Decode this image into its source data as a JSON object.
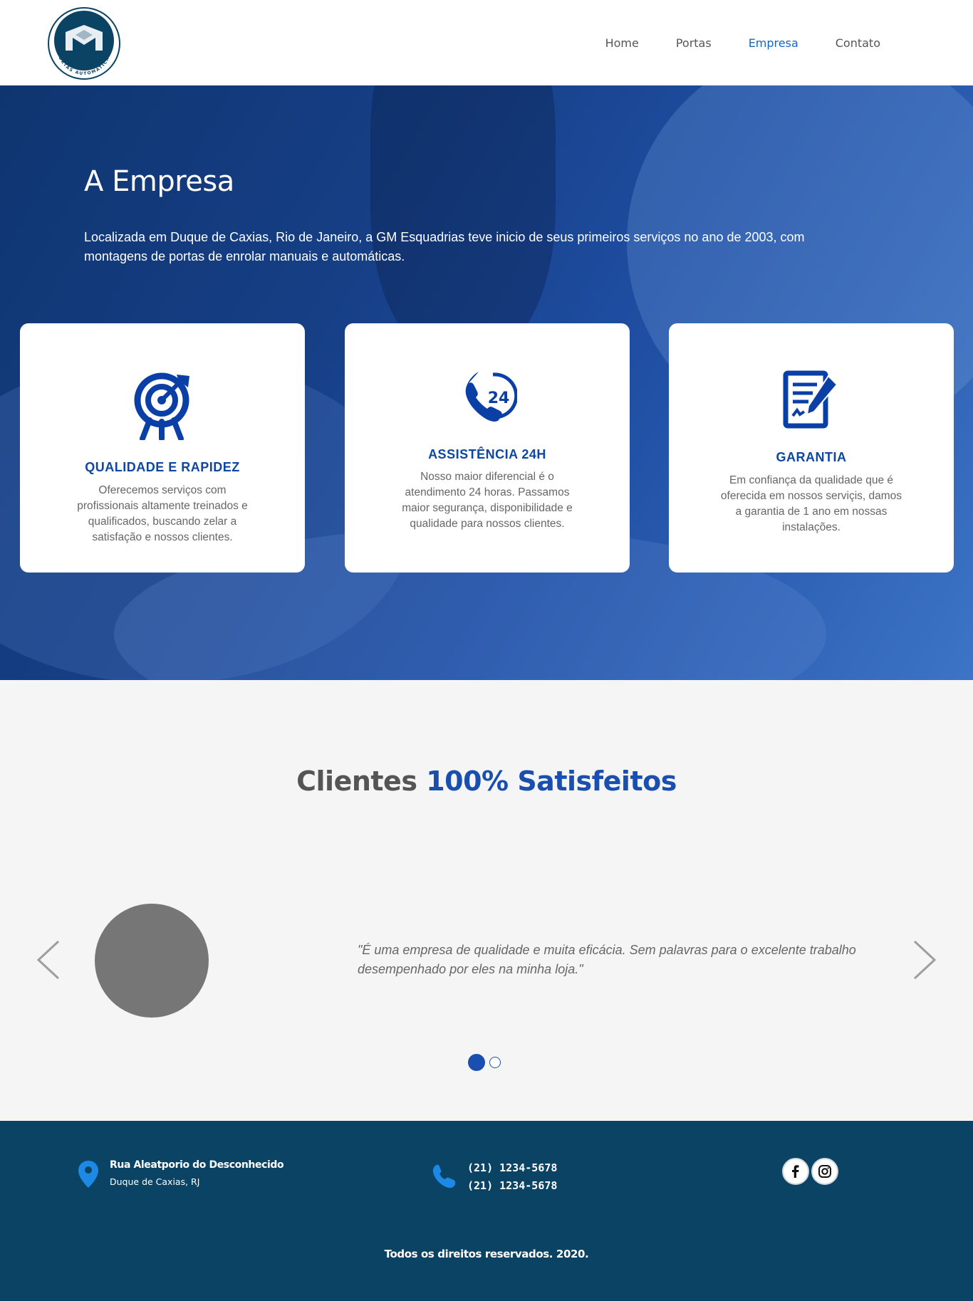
{
  "header": {
    "logo_text": "PORTAS AUTOMÁTICAS",
    "nav": [
      {
        "label": "Home",
        "active": false
      },
      {
        "label": "Portas",
        "active": false
      },
      {
        "label": "Empresa",
        "active": true
      },
      {
        "label": "Contato",
        "active": false
      }
    ]
  },
  "hero": {
    "title": "A Empresa",
    "text": "Localizada em Duque de Caxias, Rio de Janeiro, a GM Esquadrias teve inicio de seus primeiros serviços no ano de 2003, com montagens de portas de enrolar manuais e automáticas."
  },
  "cards": [
    {
      "icon": "target-icon",
      "title": "QUALIDADE E RAPIDEZ",
      "text": "Oferecemos serviços com profissionais altamente treinados e qualificados, buscando zelar a satisfação e nossos clientes."
    },
    {
      "icon": "phone-24h-icon",
      "title": "ASSISTÊNCIA 24H",
      "text": "Nosso maior diferencial é o atendimento 24 horas. Passamos maior segurança, disponibilidade e qualidade para nossos clientes."
    },
    {
      "icon": "contract-signature-icon",
      "title": "GARANTIA",
      "text": "Em confiança da qualidade que é oferecida em nossos serviçis, damos a garantia de 1 ano em nossas instalações."
    }
  ],
  "clients": {
    "title_plain": "Clientes",
    "title_accent": "100% Satisfeitos",
    "quote": "\"É uma empresa de qualidade e muita eficácia. Sem palavras para o excelente trabalho desempenhado por eles na minha loja.\"",
    "active_slide": 1,
    "slide_count": 2
  },
  "footer": {
    "address_line1": "Rua Aleatporio do Desconhecido",
    "address_line2": "Duque de Caxias, RJ",
    "phones": [
      "(21) 1234-5678",
      "(21) 1234-5678"
    ],
    "social": [
      "facebook-icon",
      "instagram-icon"
    ],
    "copyright": "Todos os direitos reservados. 2020."
  },
  "colors": {
    "accent": "#1a4fb0",
    "nav_active": "#1565c0",
    "hero_bg": "#163f86",
    "footer_bg": "#0b4364",
    "icon_blue": "#0a3fa6"
  }
}
